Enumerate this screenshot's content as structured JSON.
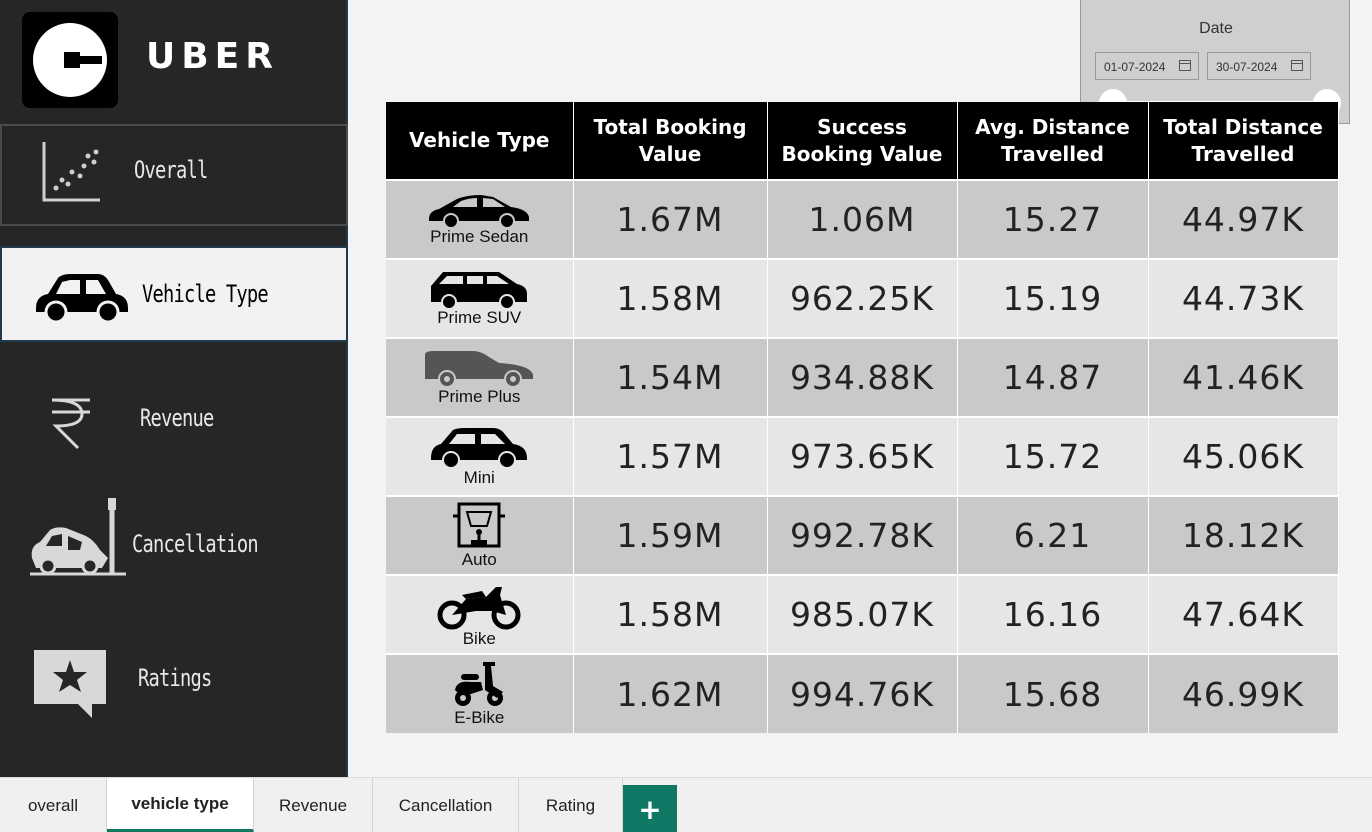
{
  "brand": {
    "name": "UBER"
  },
  "nav": [
    {
      "label": "Overall",
      "icon": "scatter-chart-icon"
    },
    {
      "label": "Vehicle Type",
      "icon": "car-icon"
    },
    {
      "label": "Revenue",
      "icon": "rupee-icon"
    },
    {
      "label": "Cancellation",
      "icon": "car-crash-icon"
    },
    {
      "label": "Ratings",
      "icon": "star-comment-icon"
    }
  ],
  "date_slicer": {
    "title": "Date",
    "start": "01-07-2024",
    "end": "30-07-2024"
  },
  "table": {
    "headers": [
      "Vehicle Type",
      "Total Booking Value",
      "Success Booking Value",
      "Avg. Distance Travelled",
      "Total Distance Travelled"
    ],
    "rows": [
      {
        "vehicle": "Prime Sedan",
        "icon": "sedan-icon",
        "total_booking": "1.67M",
        "success_booking": "1.06M",
        "avg_distance": "15.27",
        "total_distance": "44.97K"
      },
      {
        "vehicle": "Prime SUV",
        "icon": "suv-icon",
        "total_booking": "1.58M",
        "success_booking": "962.25K",
        "avg_distance": "15.19",
        "total_distance": "44.73K"
      },
      {
        "vehicle": "Prime Plus",
        "icon": "hatchback-icon",
        "total_booking": "1.54M",
        "success_booking": "934.88K",
        "avg_distance": "14.87",
        "total_distance": "41.46K"
      },
      {
        "vehicle": "Mini",
        "icon": "mini-car-icon",
        "total_booking": "1.57M",
        "success_booking": "973.65K",
        "avg_distance": "15.72",
        "total_distance": "45.06K"
      },
      {
        "vehicle": "Auto",
        "icon": "auto-rickshaw-icon",
        "total_booking": "1.59M",
        "success_booking": "992.78K",
        "avg_distance": "6.21",
        "total_distance": "18.12K"
      },
      {
        "vehicle": "Bike",
        "icon": "motorbike-icon",
        "total_booking": "1.58M",
        "success_booking": "985.07K",
        "avg_distance": "16.16",
        "total_distance": "47.64K"
      },
      {
        "vehicle": "E-Bike",
        "icon": "scooter-icon",
        "total_booking": "1.62M",
        "success_booking": "994.76K",
        "avg_distance": "15.68",
        "total_distance": "46.99K"
      }
    ]
  },
  "tabs": [
    {
      "label": "overall",
      "active": false
    },
    {
      "label": "vehicle type",
      "active": true
    },
    {
      "label": "Revenue",
      "active": false
    },
    {
      "label": "Cancellation",
      "active": false
    },
    {
      "label": "Rating",
      "active": false
    }
  ],
  "add_tab": {
    "label": "+"
  },
  "colors": {
    "sidebar": "#262626",
    "accent": "#117865",
    "header": "#000000"
  }
}
